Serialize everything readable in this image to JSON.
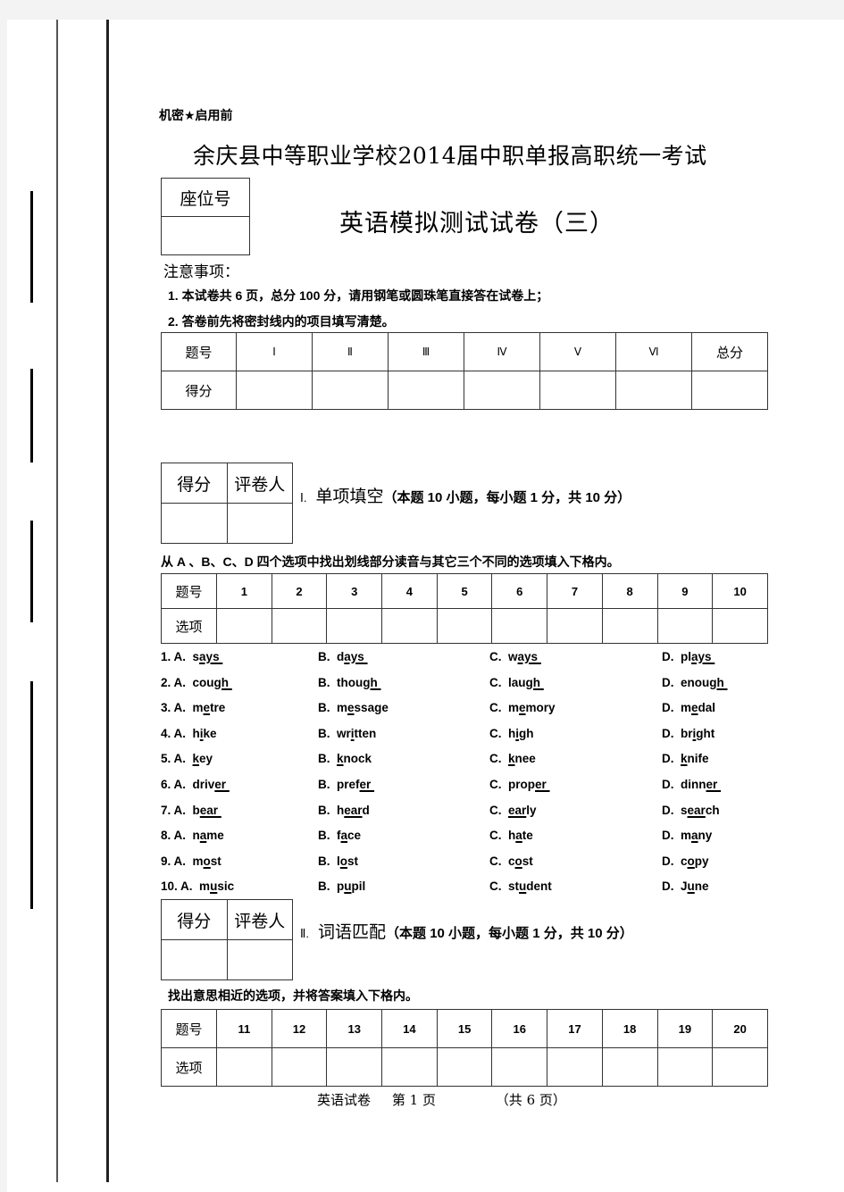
{
  "header": {
    "confidential": "机密★启用前",
    "school_title": "余庆县中等职业学校2014届中职单报高职统一考试",
    "paper_title": "英语模拟测试试卷（三）",
    "seat_label": "座位号"
  },
  "notes": {
    "title": "注意事项：",
    "items": [
      "1.  本试卷共 6 页，总分 100 分，请用钢笔或圆珠笔直接答在试卷上；",
      "2.  答卷前先将密封线内的项目填写清楚。"
    ]
  },
  "score_table": {
    "row_labels": [
      "题号",
      "得分"
    ],
    "columns": [
      "Ⅰ",
      "Ⅱ",
      "Ⅲ",
      "Ⅳ",
      "Ⅴ",
      "Ⅵ",
      "总分"
    ]
  },
  "grader_box": {
    "score_label": "得分",
    "grader_label": "评卷人"
  },
  "section1": {
    "number": "Ⅰ.",
    "title": "单项填空",
    "subtitle": "（本题 10 小题，每小题 1 分，共 10 分）",
    "instruction": "从 A  、B、C、D 四个选项中找出划线部分读音与其它三个不同的选项填入下格内。",
    "answer_table": {
      "row_labels": [
        "题号",
        "选项"
      ],
      "numbers": [
        "1",
        "2",
        "3",
        "4",
        "5",
        "6",
        "7",
        "8",
        "9",
        "10"
      ]
    },
    "questions": [
      {
        "num": "1.",
        "options": [
          {
            "letter": "A.",
            "pre": "s",
            "ul": "ays ",
            "post": ""
          },
          {
            "letter": "B.",
            "pre": "d",
            "ul": "ays ",
            "post": ""
          },
          {
            "letter": "C.",
            "pre": "w",
            "ul": "ays ",
            "post": ""
          },
          {
            "letter": "D.",
            "pre": "pl",
            "ul": "ays ",
            "post": ""
          }
        ]
      },
      {
        "num": "2.",
        "options": [
          {
            "letter": "A.",
            "pre": "cou",
            "ul": "gh ",
            "post": ""
          },
          {
            "letter": "B.",
            "pre": "thou",
            "ul": "gh ",
            "post": ""
          },
          {
            "letter": "C.",
            "pre": "lau",
            "ul": "gh ",
            "post": ""
          },
          {
            "letter": "D.",
            "pre": "enou",
            "ul": "gh ",
            "post": ""
          }
        ]
      },
      {
        "num": "3.",
        "options": [
          {
            "letter": "A.",
            "pre": "m",
            "ul": "e",
            "post": "tre"
          },
          {
            "letter": "B.",
            "pre": "m",
            "ul": "e",
            "post": "ssage"
          },
          {
            "letter": "C.",
            "pre": "m",
            "ul": "e",
            "post": "mory"
          },
          {
            "letter": "D.",
            "pre": "m",
            "ul": "e",
            "post": "dal"
          }
        ]
      },
      {
        "num": "4.",
        "options": [
          {
            "letter": "A.",
            "pre": "h",
            "ul": "i",
            "post": "ke"
          },
          {
            "letter": "B.",
            "pre": "wr",
            "ul": "i",
            "post": "tten"
          },
          {
            "letter": "C.",
            "pre": "h",
            "ul": "i",
            "post": "gh"
          },
          {
            "letter": "D.",
            "pre": "br",
            "ul": "i",
            "post": "ght"
          }
        ]
      },
      {
        "num": "5.",
        "options": [
          {
            "letter": "A.",
            "pre": "",
            "ul": "k",
            "post": "ey"
          },
          {
            "letter": "B.",
            "pre": "",
            "ul": "k",
            "post": "nock"
          },
          {
            "letter": "C.",
            "pre": "",
            "ul": "k",
            "post": "nee"
          },
          {
            "letter": "D.",
            "pre": "",
            "ul": "k",
            "post": "nife"
          }
        ]
      },
      {
        "num": "6.",
        "options": [
          {
            "letter": "A.",
            "pre": "driv",
            "ul": "er ",
            "post": ""
          },
          {
            "letter": "B.",
            "pre": "pref",
            "ul": "er ",
            "post": ""
          },
          {
            "letter": "C.",
            "pre": "prop",
            "ul": "er ",
            "post": ""
          },
          {
            "letter": "D.",
            "pre": "dinn",
            "ul": "er ",
            "post": ""
          }
        ]
      },
      {
        "num": "7.",
        "options": [
          {
            "letter": "A.",
            "pre": "b",
            "ul": "ear ",
            "post": ""
          },
          {
            "letter": "B.",
            "pre": "h",
            "ul": "ear",
            "post": "d"
          },
          {
            "letter": "C.",
            "pre": "",
            "ul": "ear",
            "post": "ly"
          },
          {
            "letter": "D.",
            "pre": "s",
            "ul": "ear",
            "post": "ch"
          }
        ]
      },
      {
        "num": "8.",
        "options": [
          {
            "letter": "A.",
            "pre": "n",
            "ul": "a",
            "post": "me"
          },
          {
            "letter": "B.",
            "pre": "f",
            "ul": "a",
            "post": "ce"
          },
          {
            "letter": "C.",
            "pre": "h",
            "ul": "a",
            "post": "te"
          },
          {
            "letter": "D.",
            "pre": "m",
            "ul": "a",
            "post": "ny"
          }
        ]
      },
      {
        "num": "9.",
        "options": [
          {
            "letter": "A.",
            "pre": "m",
            "ul": "o",
            "post": "st"
          },
          {
            "letter": "B.",
            "pre": "l",
            "ul": "o",
            "post": "st"
          },
          {
            "letter": "C.",
            "pre": "c",
            "ul": "o",
            "post": "st"
          },
          {
            "letter": "D.",
            "pre": "c",
            "ul": "o",
            "post": "py"
          }
        ]
      },
      {
        "num": "10.",
        "options": [
          {
            "letter": "A.",
            "pre": "m",
            "ul": "u",
            "post": "sic"
          },
          {
            "letter": "B.",
            "pre": "p",
            "ul": "u",
            "post": "pil"
          },
          {
            "letter": "C.",
            "pre": "st",
            "ul": "u",
            "post": "dent"
          },
          {
            "letter": "D.",
            "pre": "J",
            "ul": "u",
            "post": "ne"
          }
        ]
      }
    ]
  },
  "section2": {
    "number": "Ⅱ.",
    "title": "词语匹配",
    "subtitle": "（本题 10 小题，每小题 1 分，共 10 分）",
    "instruction": "找出意思相近的选项，并将答案填入下格内。",
    "answer_table": {
      "row_labels": [
        "题号",
        "选项"
      ],
      "numbers": [
        "11",
        "12",
        "13",
        "14",
        "15",
        "16",
        "17",
        "18",
        "19",
        "20"
      ]
    }
  },
  "footer": {
    "subject": "英语试卷",
    "page_prefix": "第",
    "page_number": "1",
    "page_suffix": "页",
    "total_prefix": "（共",
    "total_pages": "6",
    "total_suffix": "页）"
  }
}
